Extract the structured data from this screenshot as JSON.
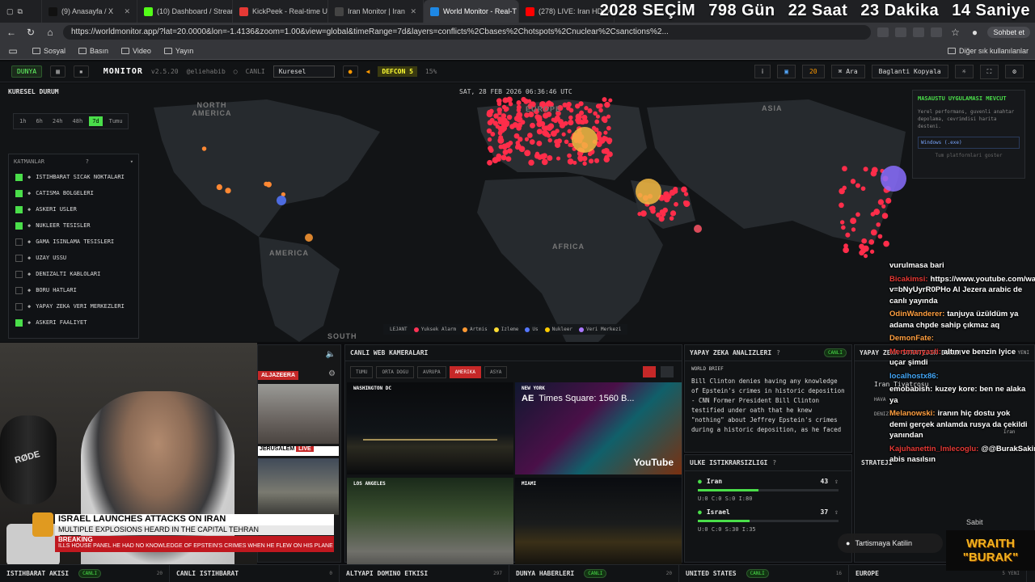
{
  "browser": {
    "tabs": [
      {
        "label": "(9) Anasayfa / X",
        "color": "#111111"
      },
      {
        "label": "(10) Dashboard / Stream",
        "color": "#53fc18"
      },
      {
        "label": "KickPeek - Real-time UI",
        "color": "#e53935"
      },
      {
        "label": "Iran Monitor | Iran",
        "color": "#444444"
      },
      {
        "label": "World Monitor - Real-T",
        "color": "#1e88e5"
      },
      {
        "label": "(278) LIVE: Iran HD",
        "color": "#ff0000"
      }
    ],
    "url": "https://worldmonitor.app/?lat=20.0000&lon=-1.4136&zoom=1.00&view=global&timeRange=7d&layers=conflicts%2Cbases%2Chotspots%2Cnuclear%2Csanctions%2...",
    "profile_label": "Sohbet et",
    "bookmarks": [
      "Sosyal",
      "Basın",
      "Video",
      "Yayın"
    ],
    "other_bookmarks": "Diğer sık kullanılanlar"
  },
  "countdown": {
    "label": "2028 SEÇİM",
    "days": "798 Gün",
    "hours": "22 Saat",
    "minutes": "23 Dakika",
    "seconds": "14 Saniye"
  },
  "app": {
    "world_label": "DUNYA",
    "logo": "MONITOR",
    "version": "v2.5.20",
    "handle": "@eliehabib",
    "live_label": "CANLI",
    "region_select": "Kuresel",
    "defcon": "DEFCON 5",
    "defcon_pct": "15%",
    "notif_count": "20",
    "search_label": "Ara",
    "copy_link": "Baglanti Kopyala"
  },
  "map": {
    "title": "KURESEL DURUM",
    "timestamp": "SAT, 28 FEB 2026 06:36:46 UTC",
    "time_ranges": [
      "1h",
      "6h",
      "24h",
      "48h",
      "7d",
      "Tumu"
    ],
    "active_range": "7d",
    "continents": [
      "NORTH AMERICA",
      "EUROPE",
      "ASIA",
      "AFRICA",
      "AMERICA",
      "SOUTH"
    ],
    "layers_title": "KATMANLAR",
    "layers": [
      {
        "label": "ISTIHBARAT SICAK NOKTALARI",
        "on": true
      },
      {
        "label": "CATISMA BOLGELERI",
        "on": true
      },
      {
        "label": "ASKERI USLER",
        "on": true
      },
      {
        "label": "NUKLEER TESISLER",
        "on": true
      },
      {
        "label": "GAMA ISINLAMA TESISLERI",
        "on": false
      },
      {
        "label": "UZAY USSU",
        "on": false
      },
      {
        "label": "DENIZALTI KABLOLARI",
        "on": false
      },
      {
        "label": "BORU HATLARI",
        "on": false
      },
      {
        "label": "YAPAY ZEKA VERI MERKEZLERI",
        "on": false
      },
      {
        "label": "ASKERI FAALIYET",
        "on": true
      }
    ],
    "legend_title": "LEJANT",
    "legend": [
      {
        "label": "Yuksek Alarm",
        "color": "#ff3355"
      },
      {
        "label": "Artmis",
        "color": "#ff9933"
      },
      {
        "label": "Izleme",
        "color": "#ffdd33"
      },
      {
        "label": "Us",
        "color": "#5577ff"
      },
      {
        "label": "Nukleer",
        "color": "#ffcc00"
      },
      {
        "label": "Veri Merkezi",
        "color": "#aa77ff"
      }
    ],
    "desktop_popup": {
      "title": "MASAUSTU UYGULAMASI MEVCUT",
      "desc": "Yerel performans, guvenli anahtar depolama, cevrimdisi harita desteni.",
      "button": "Windows (.exe)",
      "all": "Tum platformlari goster"
    }
  },
  "news_panel": {
    "channel": "ALJAZEERA",
    "tag": "JERUSALEM",
    "live": "LIVE"
  },
  "cams": {
    "title": "CANLI WEB KAMERALARI",
    "tabs": [
      "TUMU",
      "ORTA DOGU",
      "AVRUPA",
      "AMERIKA",
      "ASYA"
    ],
    "active_tab": "AMERIKA",
    "feeds": [
      {
        "label": "WASHINGTON DC"
      },
      {
        "label": "NEW YORK",
        "title": "Times Square: 1560 B...",
        "channel": "AE",
        "yt": "YouTube"
      },
      {
        "label": "LOS ANGELES"
      },
      {
        "label": "MIAMI"
      }
    ]
  },
  "ai": {
    "title": "YAPAY ZEKA ANALIZLERI",
    "badge": "CANLI",
    "brief_tag": "WORLD BRIEF",
    "brief": "Bill Clinton denies having any knowledge of Epstein's crimes in historic deposition - CNN Former President Bill Clinton testified under oath that he knew \"nothing\" about Jeffrey Epstein's crimes during a historic deposition, as he faced"
  },
  "instability": {
    "title": "ULKE ISTIKRARSIZLIGI",
    "countries": [
      {
        "name": "Iran",
        "score": "43",
        "level": 0.43,
        "meta": "U:0  C:0  S:0  I:80"
      },
      {
        "name": "Israel",
        "score": "37",
        "level": 0.37,
        "meta": "U:0  C:0  S:30  I:35"
      }
    ]
  },
  "strategic": {
    "title": "YAPAY ZEKA STRATEJIK DURUM",
    "new": "1 YENI",
    "sub": "STRATEJI",
    "theater": "Iran Tiyatrosu",
    "items": [
      "HAVA",
      "DENIZ"
    ],
    "pinned": "Sabit",
    "side": "Iran"
  },
  "footer": [
    {
      "label": "ISTIHBARAT AKISI",
      "badge": "CANLI",
      "n": "20"
    },
    {
      "label": "CANLI ISTIHBARAT",
      "badge": "",
      "n": "0"
    },
    {
      "label": "ALTYAPI DOMINO ETKISI",
      "badge": "",
      "n": "297"
    },
    {
      "label": "DUNYA HABERLERI",
      "badge": "CANLI",
      "n": "20"
    },
    {
      "label": "UNITED STATES",
      "badge": "CANLI",
      "n": "16"
    },
    {
      "label": "EUROPE",
      "badge": "",
      "n": "5 YENI"
    }
  ],
  "broadcast": {
    "headline": "ISRAEL LAUNCHES ATTACKS ON IRAN",
    "subline": "MULTIPLE EXPLOSIONS HEARD IN THE CAPITAL TEHRAN",
    "breaking": "BREAKING",
    "ticker": "ILLS HOUSE PANEL HE HAD NO KNOWLEDGE OF EPSTEIN'S CRIMES WHEN HE FLEW ON HIS PLANE",
    "mic_brand": "RØDE"
  },
  "chat": [
    {
      "user": "",
      "msg": "vurulmasa bari",
      "color": "#ffffff"
    },
    {
      "user": "Bicakimsi:",
      "msg": "https://www.youtube.com/watch?v=bNyUyrR0PHo Al Jezera arabic de canlı yayında",
      "color": "#e53935"
    },
    {
      "user": "OdinWanderer:",
      "msg": "tanjuya üzüldüm ya adama chpde sahip çıkmaz aq",
      "color": "#ff9f40"
    },
    {
      "user": "DemonFate:",
      "msg": "",
      "color": "#ff9f40"
    },
    {
      "user": "Mertmanyasli:",
      "msg": "altın ve benzin lyice uçar şimdi",
      "color": "#e53935"
    },
    {
      "user": "localhostx86:",
      "msg": "",
      "color": "#42a5f5"
    },
    {
      "user": "emobabish:",
      "msg": "kuzey kore: ben ne alaka ya",
      "color": "#ffffff"
    },
    {
      "user": "Melanowski:",
      "msg": "iranın hiç dostu yok demi gerçek anlamda rusya da çekildi yanından",
      "color": "#ff9f40"
    },
    {
      "user": "Kajuhanettin_lmlecoglu:",
      "msg": "@@BurakSakinOl abis nasılsın",
      "color": "#e53935"
    }
  ],
  "join_label": "Tartismaya Katilin",
  "overlay_logo": "WRAITH \"BURAK\""
}
